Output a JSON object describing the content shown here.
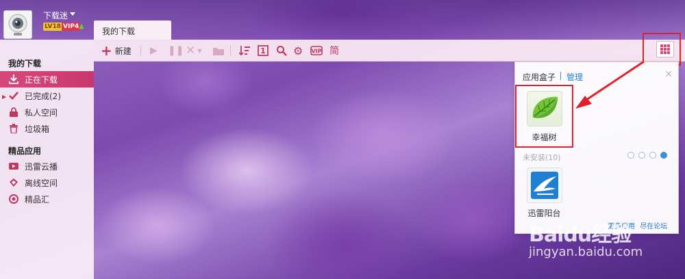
{
  "user": {
    "name": "下载迷",
    "level": "LV18",
    "vip": "VIP4"
  },
  "tab": {
    "label": "我的下载"
  },
  "toolbar": {
    "new_label": "新建"
  },
  "sidebar": {
    "my_downloads_heading": "我的下载",
    "items": [
      {
        "label": "正在下载",
        "icon": "download-icon",
        "active": true
      },
      {
        "label": "已完成(2)",
        "icon": "checkmark-icon",
        "active": false
      },
      {
        "label": "私人空间",
        "icon": "lock-icon",
        "active": false
      },
      {
        "label": "垃圾箱",
        "icon": "trash-icon",
        "active": false
      }
    ],
    "apps_heading": "精品应用",
    "app_items": [
      {
        "label": "迅雷云播",
        "icon": "cloud-play-icon"
      },
      {
        "label": "离线空间",
        "icon": "offline-space-icon"
      },
      {
        "label": "精品汇",
        "icon": "boutique-icon"
      }
    ]
  },
  "app_box": {
    "title": "应用盒子",
    "manage": "管理",
    "installed": [
      {
        "label": "幸福树",
        "icon": "leaf-icon"
      }
    ],
    "uninstalled_label": "未安装(10)",
    "uninstalled": [
      {
        "label": "迅雷阳台",
        "icon": "thunder-balcony-icon"
      }
    ],
    "more_apps": "更多应用",
    "forum": "尽在论坛",
    "page_dots": 4,
    "active_dot": 4
  },
  "watermark": {
    "logo": "Baidu经验",
    "url": "jingyan.baidu.com"
  },
  "colors": {
    "accent": "#c9386c",
    "highlight_box": "#e0202a",
    "link": "#2a7ec8"
  }
}
